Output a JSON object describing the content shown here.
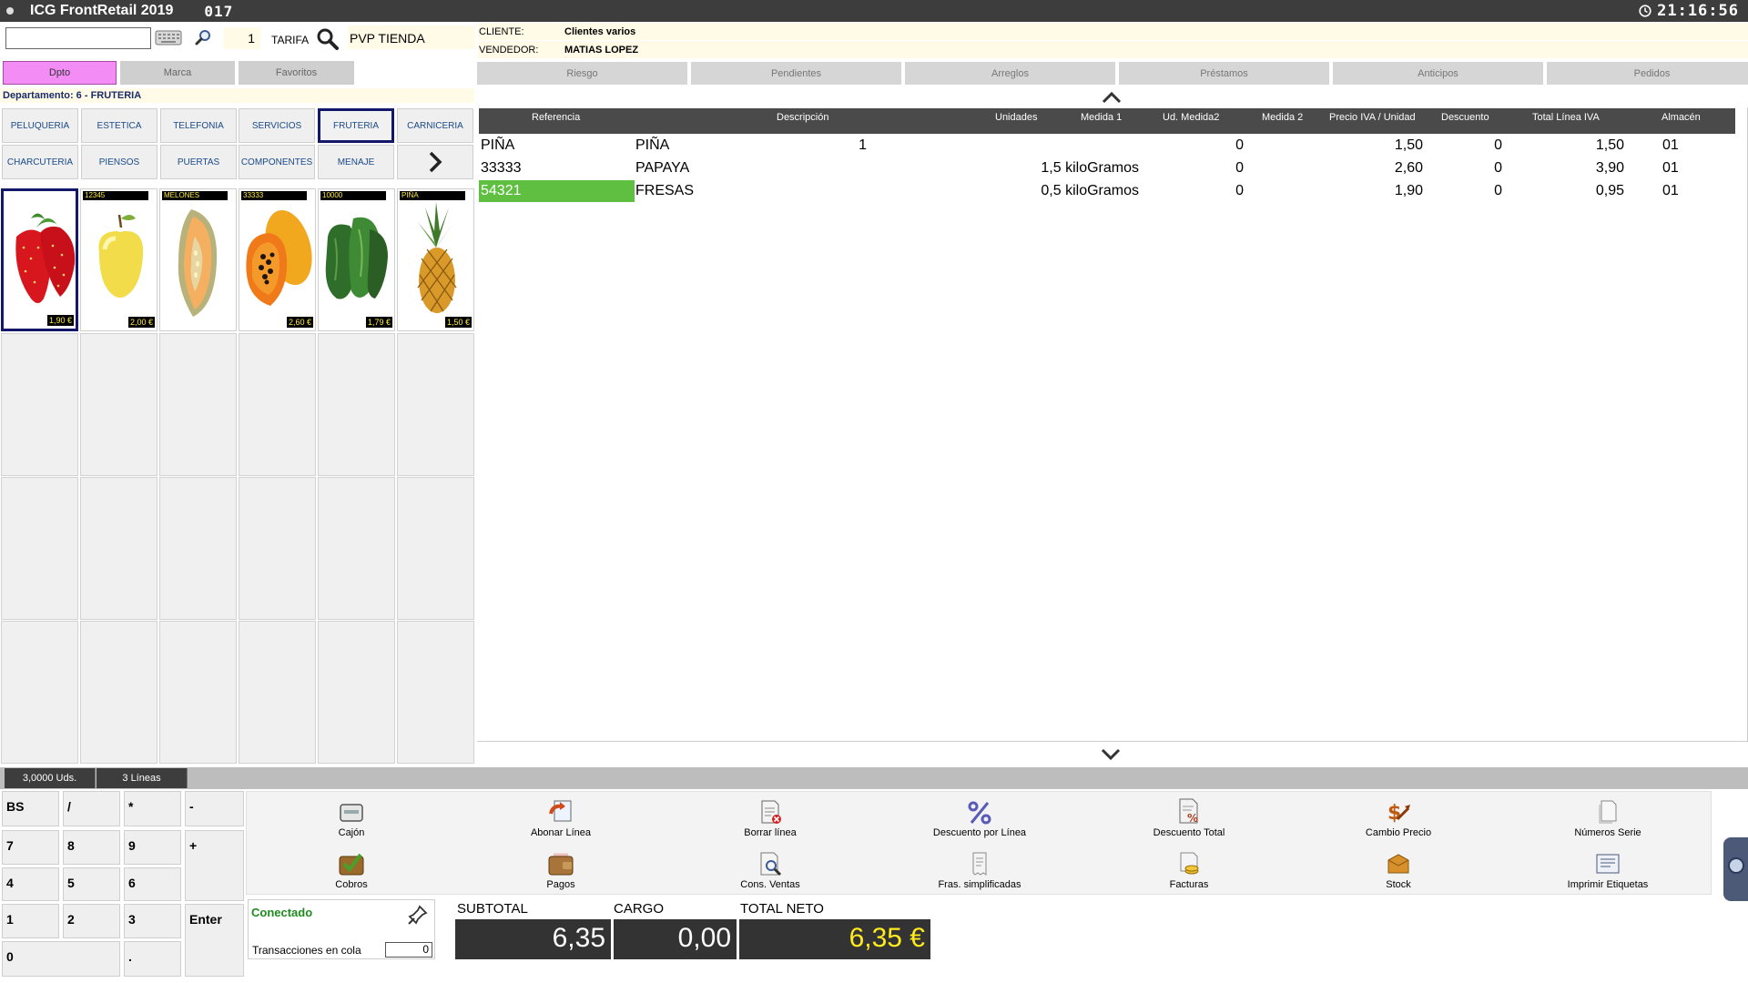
{
  "titlebar": {
    "app_title": "ICG FrontRetail 2019",
    "terminal_code": "017",
    "clock": "21:16:56"
  },
  "search": {
    "input_value": "",
    "quantity": "1",
    "tarifa_label": "TARIFA",
    "tarifa_value": "PVP TIENDA"
  },
  "client": {
    "cliente_label": "CLIENTE:",
    "cliente_value": "Clientes varios",
    "vendedor_label": "VENDEDOR:",
    "vendedor_value": "MATIAS LOPEZ"
  },
  "left_tabs": [
    "Dpto",
    "Marca",
    "Favoritos"
  ],
  "department_label": "Departamento: 6 - FRUTERIA",
  "families": [
    "PELUQUERIA",
    "ESTETICA",
    "TELEFONIA",
    "SERVICIOS",
    "FRUTERIA",
    "CARNICERIA",
    "CHARCUTERIA",
    "PIENSOS",
    "PUERTAS",
    "COMPONENTES",
    "MENAJE"
  ],
  "active_family": "FRUTERIA",
  "products": [
    {
      "code": "",
      "price": "1,90 €",
      "fruit": "strawberry-image"
    },
    {
      "code": "12345",
      "price": "2,00 €",
      "fruit": "apple-image"
    },
    {
      "code": "MELONES",
      "price": "",
      "fruit": "melon-image"
    },
    {
      "code": "33333",
      "price": "2,60 €",
      "fruit": "papaya-image"
    },
    {
      "code": "10000",
      "price": "1,79 €",
      "fruit": "cucumber-image"
    },
    {
      "code": "PIÑA",
      "price": "1,50 €",
      "fruit": "pineapple-image"
    }
  ],
  "right_tabs": [
    "Riesgo",
    "Pendientes",
    "Arreglos",
    "Préstamos",
    "Anticipos",
    "Pedidos"
  ],
  "table": {
    "headers": [
      "Referencia",
      "Descripción",
      "Unidades",
      "Medida 1",
      "Ud. Medida2",
      "Medida 2",
      "Precio IVA / Unidad",
      "Descuento",
      "Total Línea IVA",
      "Almacén"
    ],
    "rows": [
      {
        "ref": "PIÑA",
        "desc": "PIÑA",
        "units": "1",
        "ud_medida2": "0",
        "price": "1,50",
        "discount": "0",
        "total": "1,50",
        "store": "01"
      },
      {
        "ref": "33333",
        "desc": "PAPAYA",
        "units": "1,5 kiloGramos",
        "ud_medida2": "0",
        "price": "2,60",
        "discount": "0",
        "total": "3,90",
        "store": "01"
      },
      {
        "ref": "54321",
        "desc": "FRESAS",
        "units": "0,5 kiloGramos",
        "ud_medida2": "0",
        "price": "1,90",
        "discount": "0",
        "total": "0,95",
        "store": "01"
      }
    ]
  },
  "status": {
    "units": "3,0000 Uds.",
    "lines": "3 Líneas"
  },
  "keypad": {
    "bs": "BS",
    "div": "/",
    "mul": "*",
    "minus": "-",
    "k7": "7",
    "k8": "8",
    "k9": "9",
    "plus": "+",
    "k4": "4",
    "k5": "5",
    "k6": "6",
    "k1": "1",
    "k2": "2",
    "k3": "3",
    "enter": "Enter",
    "k0": "0",
    "dot": "."
  },
  "actions": {
    "cajon": "Cajón",
    "abonar": "Abonar Línea",
    "borrar": "Borrar línea",
    "desc_linea": "Descuento por Línea",
    "desc_total": "Descuento Total",
    "cambio_precio": "Cambio Precio",
    "numeros_serie": "Números Serie",
    "cobros": "Cobros",
    "pagos": "Pagos",
    "cons_ventas": "Cons. Ventas",
    "fras": "Fras. simplificadas",
    "facturas": "Facturas",
    "stock": "Stock",
    "imprimir": "Imprimir Etiquetas"
  },
  "connection": {
    "state": "Conectado",
    "queue_label": "Transacciones en cola",
    "queue_value": "0"
  },
  "totals": {
    "subtotal_label": "SUBTOTAL",
    "subtotal_value": "6,35",
    "cargo_label": "CARGO",
    "cargo_value": "0,00",
    "neto_label": "TOTAL NETO",
    "neto_value": "6,35 €"
  },
  "colors": {
    "selected_row": "#5fbf40",
    "active_tab": "#f48cf5",
    "total_neto": "#ffeb1f",
    "connected": "#1f8a1f"
  }
}
